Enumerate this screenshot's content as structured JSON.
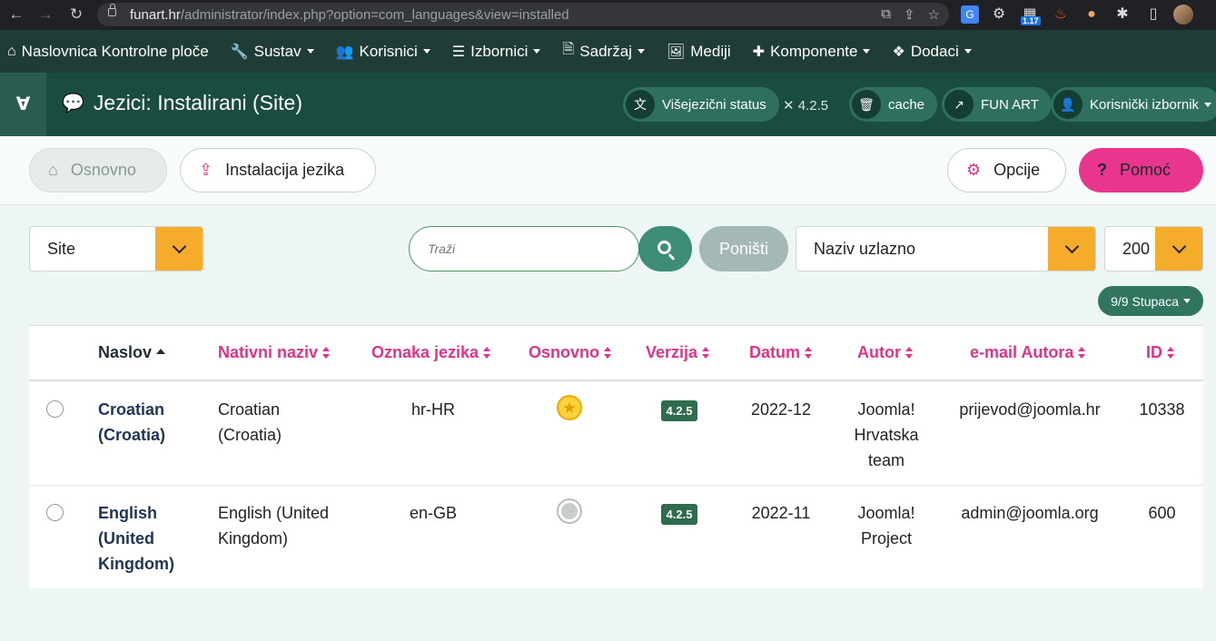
{
  "browser": {
    "url_host": "funart.hr",
    "url_path": "/administrator/index.php?option=com_languages&view=installed",
    "ext_badge": "1.17"
  },
  "topmenu": [
    {
      "icon": "home-icon",
      "glyph": "⌂",
      "label": "Naslovnica Kontrolne ploče",
      "dropdown": false
    },
    {
      "icon": "wrench-icon",
      "glyph": "🔧",
      "label": "Sustav",
      "dropdown": true
    },
    {
      "icon": "users-icon",
      "glyph": "👥",
      "label": "Korisnici",
      "dropdown": true
    },
    {
      "icon": "list-icon",
      "glyph": "☰",
      "label": "Izbornici",
      "dropdown": true
    },
    {
      "icon": "file-icon",
      "glyph": "🗎",
      "label": "Sadržaj",
      "dropdown": true
    },
    {
      "icon": "image-icon",
      "glyph": "🖼",
      "label": "Mediji",
      "dropdown": false
    },
    {
      "icon": "puzzle-icon",
      "glyph": "✚",
      "label": "Komponente",
      "dropdown": true
    },
    {
      "icon": "cubes-icon",
      "glyph": "❖",
      "label": "Dodaci",
      "dropdown": true
    }
  ],
  "header": {
    "title": "Jezici: Instalirani (Site)",
    "multilang_status": "Višejezični status",
    "version": "4.2.5",
    "cache": "cache",
    "site_link": "FUN ART",
    "user_menu": "Korisnički izbornik"
  },
  "toolbar": {
    "home": "Osnovno",
    "install": "Instalacija jezika",
    "options": "Opcije",
    "help": "Pomoć"
  },
  "filters": {
    "client": "Site",
    "search_placeholder": "Traži",
    "reset": "Poništi",
    "ordering": "Naziv uzlazno",
    "limit": "200",
    "columns": "9/9 Stupaca"
  },
  "table": {
    "headers": {
      "title": "Naslov",
      "native": "Nativni naziv",
      "tag": "Oznaka jezika",
      "default": "Osnovno",
      "version": "Verzija",
      "date": "Datum",
      "author": "Autor",
      "email": "e-mail Autora",
      "id": "ID"
    },
    "rows": [
      {
        "title_line1": "Croatian",
        "title_line2": "(Croatia)",
        "title_line3": "",
        "native_line1": "Croatian",
        "native_line2": "(Croatia)",
        "tag": "hr-HR",
        "is_default": true,
        "version": "4.2.5",
        "date": "2022-12",
        "author_line1": "Joomla!",
        "author_line2": "Hrvatska",
        "author_line3": "team",
        "email": "prijevod@joomla.hr",
        "id": "10338"
      },
      {
        "title_line1": "English",
        "title_line2": "(United",
        "title_line3": "Kingdom)",
        "native_line1": "English (United",
        "native_line2": "Kingdom)",
        "tag": "en-GB",
        "is_default": false,
        "version": "4.2.5",
        "date": "2022-11",
        "author_line1": "Joomla!",
        "author_line2": "Project",
        "author_line3": "",
        "email": "admin@joomla.org",
        "id": "600"
      }
    ]
  },
  "colors": {
    "topmenu_bg": "#1f3d36",
    "header_bg": "#1a4c40",
    "accent_pink": "#e0328a",
    "select_orange": "#f4ac2a",
    "search_green": "#3d8c77"
  }
}
